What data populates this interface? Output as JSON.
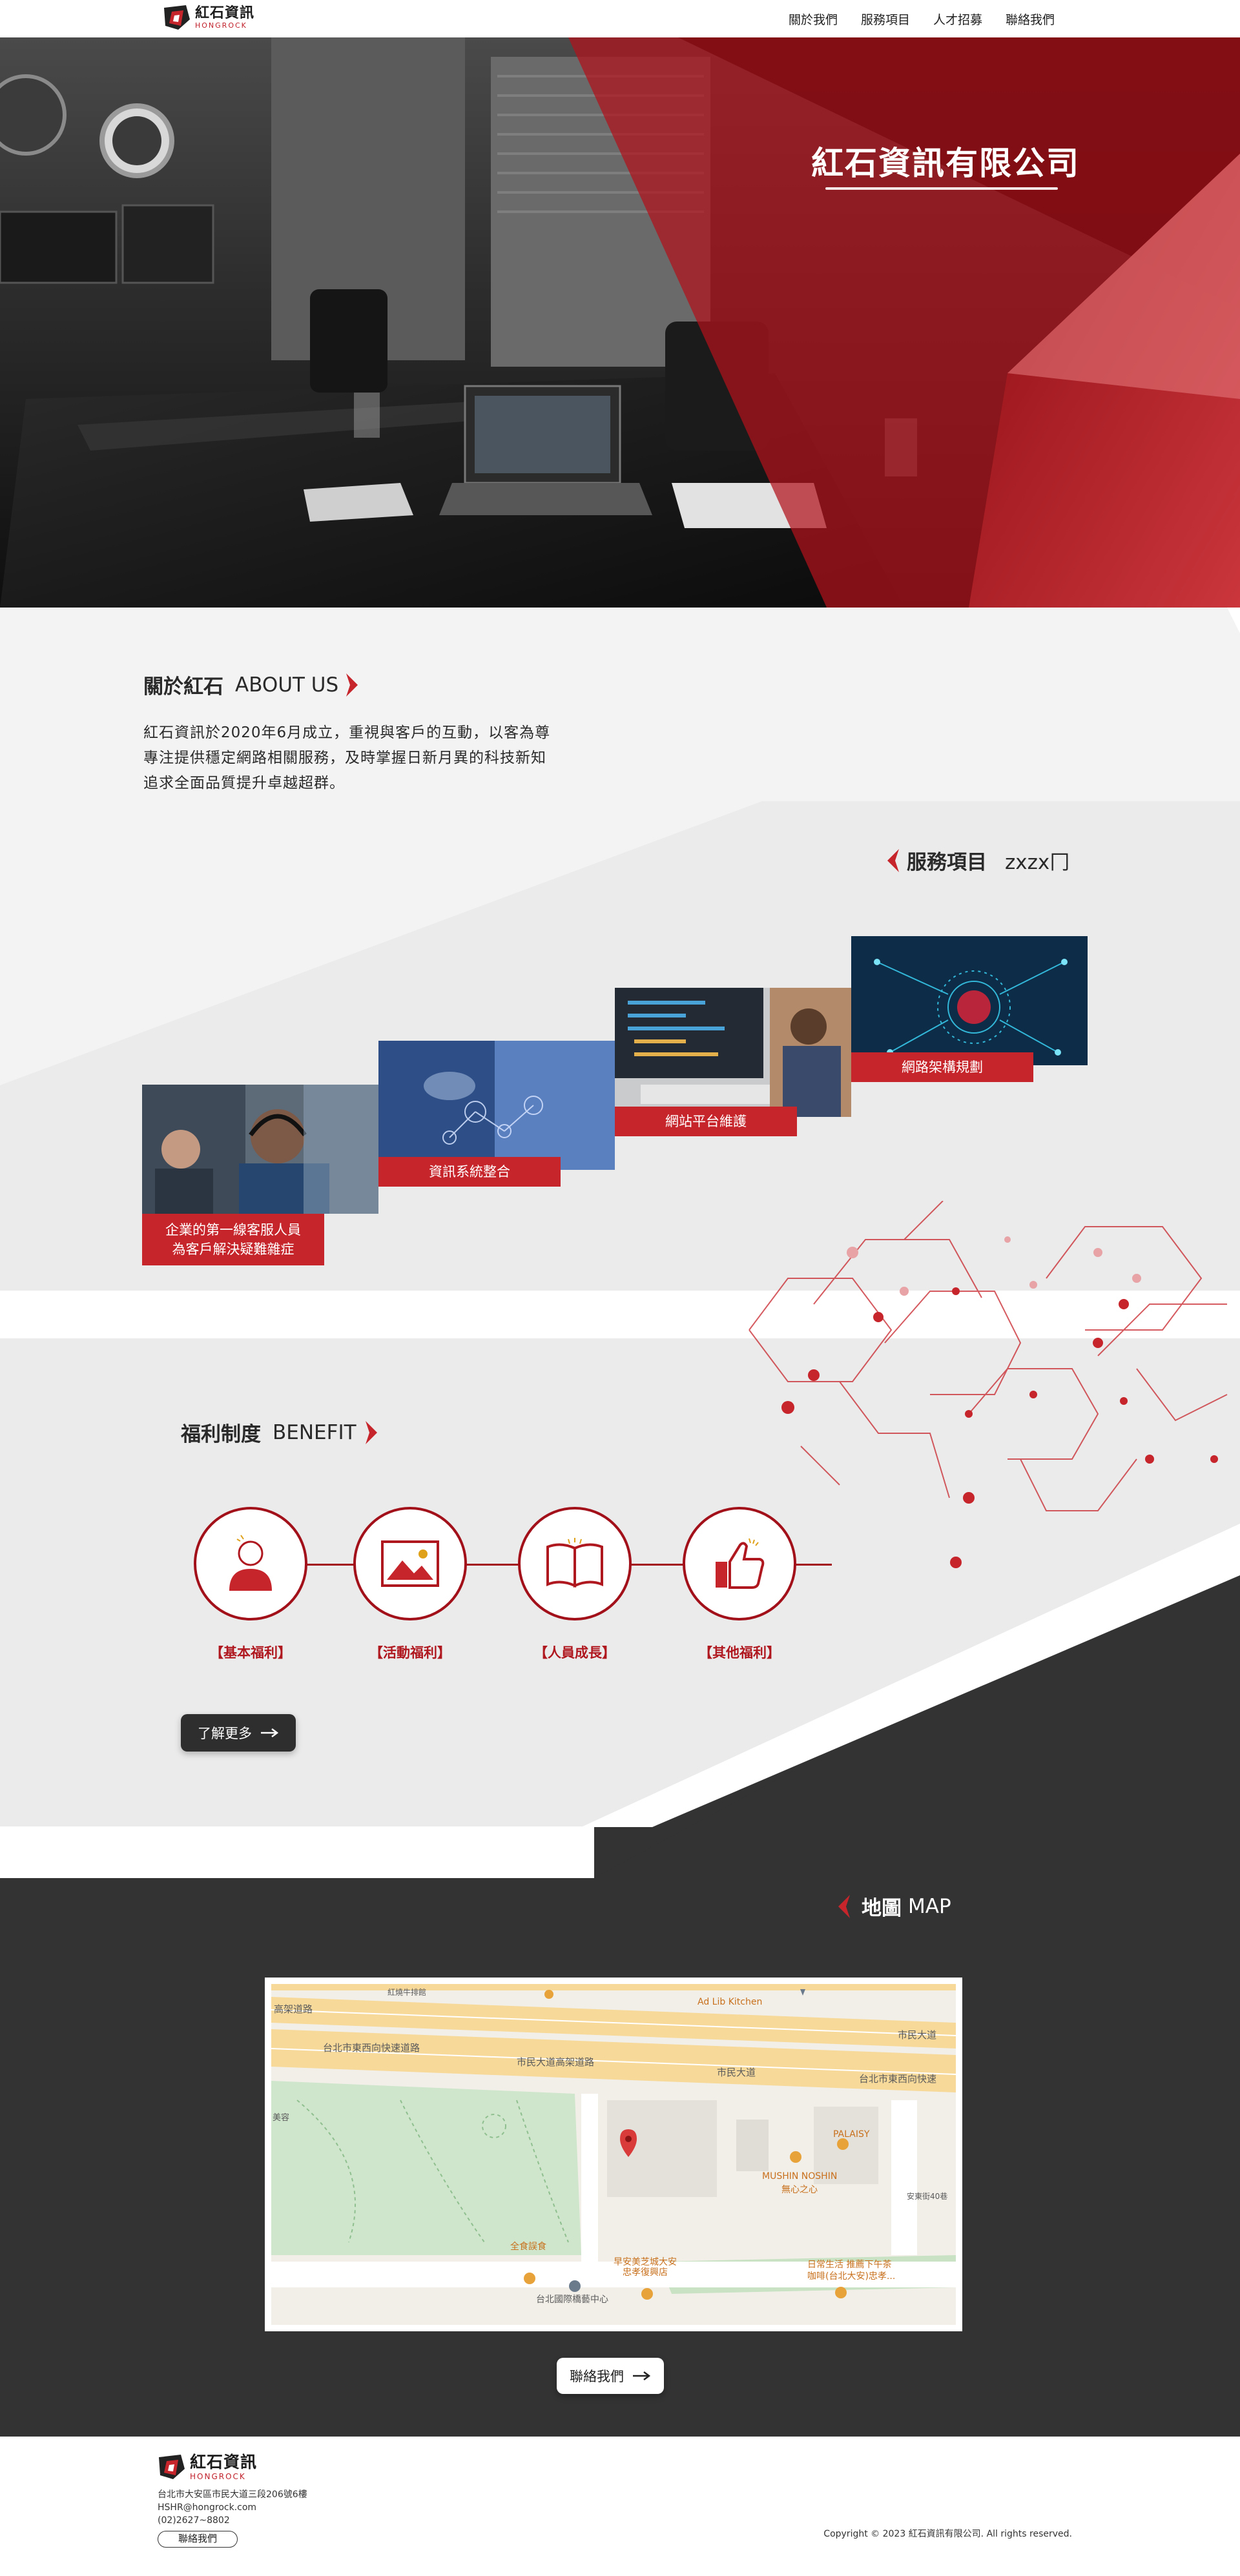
{
  "brand": {
    "name_cn": "紅石資訊",
    "name_en": "HONGROCK",
    "colors": {
      "red": "#c7252c",
      "dark_red": "#a2101a",
      "charcoal": "#333333",
      "light_gray": "#ececec"
    }
  },
  "nav": {
    "items": [
      {
        "label": "關於我們"
      },
      {
        "label": "服務項目"
      },
      {
        "label": "人才招募"
      },
      {
        "label": "聯絡我們"
      }
    ]
  },
  "hero": {
    "title": "紅石資訊有限公司"
  },
  "about": {
    "title_cn": "關於紅石",
    "title_en": "ABOUT US",
    "lines": [
      "紅石資訊於2020年6月成立，重視與客戶的互動，以客為尊",
      "專注提供穩定網路相關服務，及時掌握日新月異的科技新知",
      "追求全面品質提升卓越超群。"
    ]
  },
  "services": {
    "title_cn": "服務項目",
    "title_en": "zxzx⼌",
    "cards": [
      {
        "label": "企業的第一線客服人員\n為客戶解決疑難雜症",
        "image": "customer-service-photo"
      },
      {
        "label": "資訊系統整合",
        "image": "system-integration-photo"
      },
      {
        "label": "網站平台維護",
        "image": "website-maintenance-photo"
      },
      {
        "label": "網路架構規劃",
        "image": "network-architecture-photo"
      }
    ]
  },
  "benefit": {
    "title_cn": "福利制度",
    "title_en": "BENEFIT",
    "items": [
      {
        "label": "【基本福利】",
        "icon": "person-icon"
      },
      {
        "label": "【活動福利】",
        "icon": "picture-icon"
      },
      {
        "label": "【人員成長】",
        "icon": "book-icon"
      },
      {
        "label": "【其他福利】",
        "icon": "thumbs-up-icon"
      }
    ],
    "more_label": "了解更多"
  },
  "map": {
    "title_cn": "地圖",
    "title_en": "MAP",
    "labels": {
      "road_top_left": "高架道路",
      "road_top_small": "紅燒牛排館",
      "road_1": "台北市東西向快速道路",
      "road_2": "市民大道高架道路",
      "road_3": "市民大道",
      "road_4": "台北市東西向快速",
      "road_5": "市民大道",
      "poi_kitchen": "Ad Lib Kitchen",
      "poi_palaisy": "PALAISY",
      "poi_mushin": "MUSHIN NOSHIN",
      "poi_mushin_cn": "無心之心",
      "poi_center": "台北國際橋藝中心",
      "poi_shop": "早安美芝城大安",
      "poi_shop2": "忠孝復興店",
      "poi_cafe": "日常生活 推薦下午茶",
      "poi_cafe2": "咖啡(台北大安)忠孝...",
      "poi_food": "全食誤食",
      "road_side": "安東街40巷",
      "poi_left": "美容"
    },
    "contact_label": "聯絡我們"
  },
  "footer": {
    "address": "台北市大安區市民大道三段206號6樓",
    "email": "HSHR@hongrock.com",
    "phone": "(02)2627~8802",
    "contact_label": "聯絡我們",
    "copyright": "Copyright © 2023 紅石資訊有限公司. All rights reserved."
  }
}
